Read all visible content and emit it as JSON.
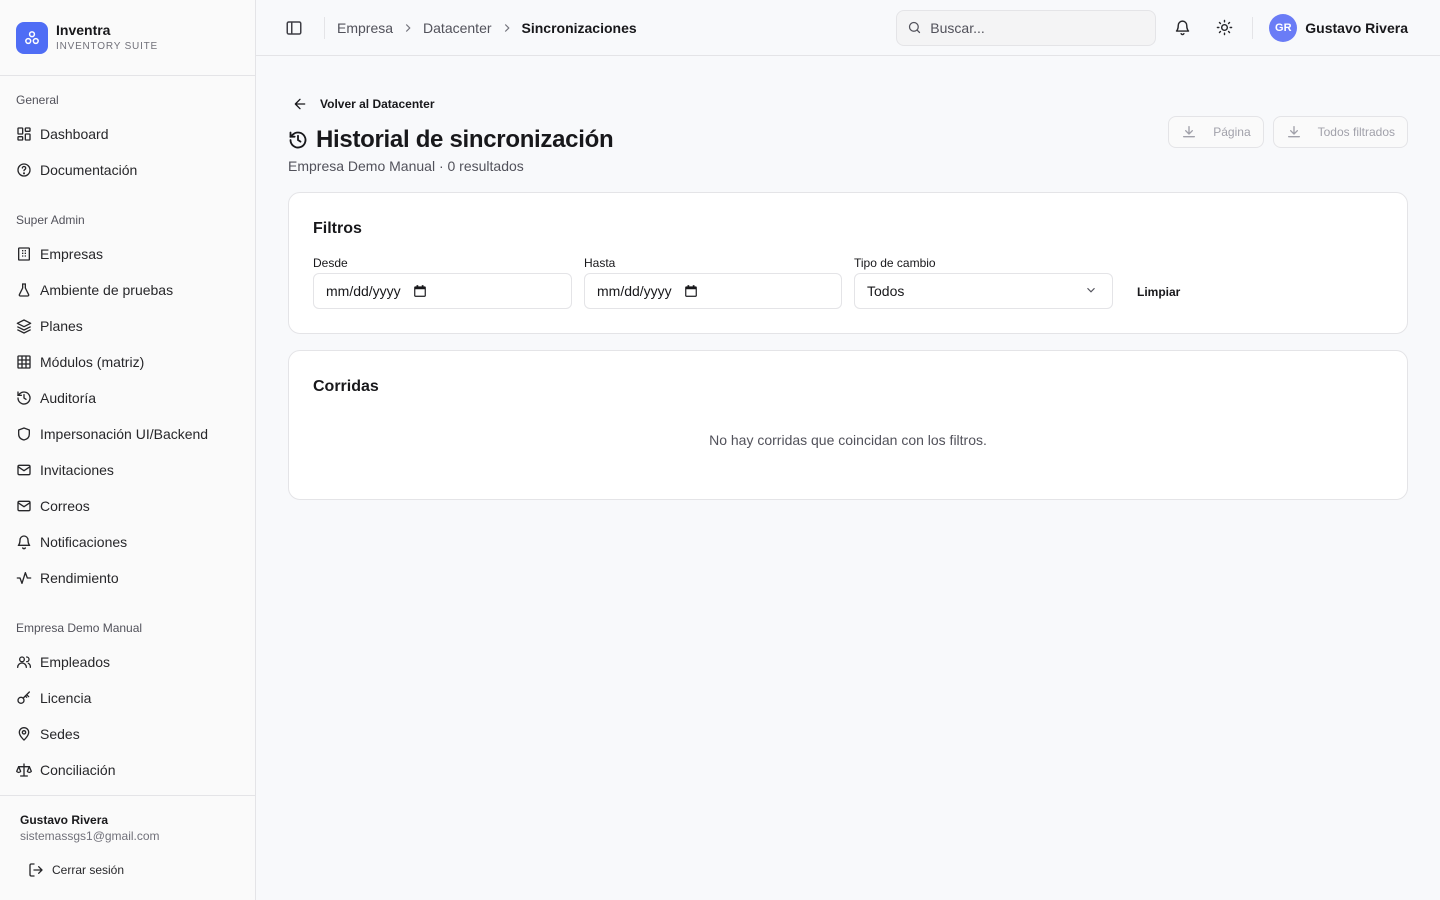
{
  "brand": {
    "name": "Inventra",
    "subtitle": "INVENTORY SUITE",
    "accent": "#4f6df5"
  },
  "sidebar": {
    "sections": [
      {
        "title": "General",
        "items": [
          {
            "label": "Dashboard",
            "icon": "dashboard-icon"
          },
          {
            "label": "Documentación",
            "icon": "help-circle-icon"
          }
        ]
      },
      {
        "title": "Super Admin",
        "items": [
          {
            "label": "Empresas",
            "icon": "building-icon"
          },
          {
            "label": "Ambiente de pruebas",
            "icon": "flask-icon"
          },
          {
            "label": "Planes",
            "icon": "layers-icon"
          },
          {
            "label": "Módulos (matriz)",
            "icon": "table-icon"
          },
          {
            "label": "Auditoría",
            "icon": "history-icon"
          },
          {
            "label": "Impersonación UI/Backend",
            "icon": "shield-icon"
          },
          {
            "label": "Invitaciones",
            "icon": "mail-icon"
          },
          {
            "label": "Correos",
            "icon": "mail-icon"
          },
          {
            "label": "Notificaciones",
            "icon": "bell-icon"
          },
          {
            "label": "Rendimiento",
            "icon": "activity-icon"
          }
        ]
      },
      {
        "title": "Empresa Demo Manual",
        "items": [
          {
            "label": "Empleados",
            "icon": "users-icon"
          },
          {
            "label": "Licencia",
            "icon": "key-icon"
          },
          {
            "label": "Sedes",
            "icon": "map-pin-icon"
          },
          {
            "label": "Conciliación",
            "icon": "scale-icon"
          }
        ]
      }
    ],
    "footer": {
      "user_name": "Gustavo Rivera",
      "user_email": "sistemassgs1@gmail.com",
      "logout_label": "Cerrar sesión"
    }
  },
  "header": {
    "breadcrumb": [
      "Empresa",
      "Datacenter",
      "Sincronizaciones"
    ],
    "search_placeholder": "Buscar...",
    "user_initials": "GR",
    "user_name": "Gustavo Rivera"
  },
  "main": {
    "back_label": "Volver al Datacenter",
    "title": "Historial de sincronización",
    "subtitle": "Empresa Demo Manual · 0 resultados",
    "export_page_label": "Página",
    "export_all_label": "Todos filtrados",
    "filters": {
      "title": "Filtros",
      "from_label": "Desde",
      "from_value": "mm/dd/yyyy",
      "to_label": "Hasta",
      "to_value": "mm/dd/yyyy",
      "type_label": "Tipo de cambio",
      "type_value": "Todos",
      "clear_label": "Limpiar"
    },
    "runs": {
      "title": "Corridas",
      "empty_message": "No hay corridas que coincidan con los filtros."
    }
  }
}
